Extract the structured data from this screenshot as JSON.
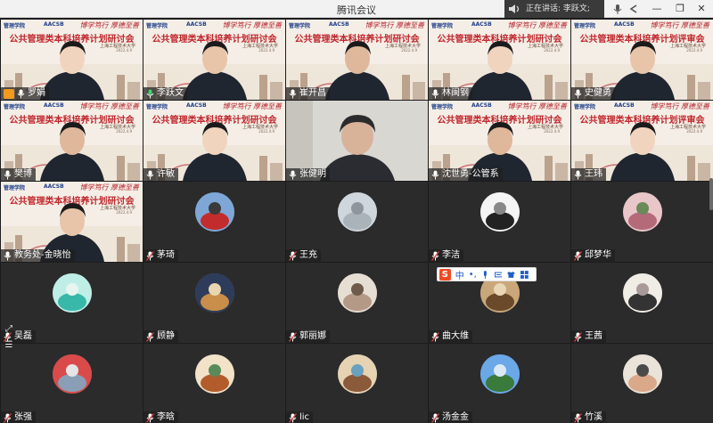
{
  "window": {
    "title": "腾讯会议",
    "speaking_label": "正在讲话: 李跃文;",
    "controls": [
      "—",
      "❐",
      "✕"
    ]
  },
  "slide": {
    "logo_left": "管理学院",
    "logo_right": "AACSB",
    "motto": "博学笃行 厚德至善",
    "title_seminar": "公共管理类本科培养计划研讨会",
    "title_review": "公共管理类本科培养计划评审会",
    "subtitle": "上海工程技术大学",
    "date": "2022.4.9"
  },
  "participants": [
    {
      "name": "罗娟",
      "type": "slide-person",
      "slide": "seminar",
      "host": true
    },
    {
      "name": "李跃文",
      "type": "slide-person",
      "slide": "seminar",
      "speaking": true
    },
    {
      "name": "崔开昌",
      "type": "slide-person",
      "slide": "seminar"
    },
    {
      "name": "林闽钢",
      "type": "slide-person",
      "slide": "seminar"
    },
    {
      "name": "史健勇",
      "type": "slide-person",
      "slide": "review"
    },
    {
      "name": "樊博",
      "type": "slide-person",
      "slide": "seminar"
    },
    {
      "name": "许敏",
      "type": "slide-person",
      "slide": "seminar"
    },
    {
      "name": "张健明",
      "type": "camera"
    },
    {
      "name": "沈世勇-公管系",
      "type": "slide-person",
      "slide": "seminar"
    },
    {
      "name": "王玮",
      "type": "slide-person",
      "slide": "review"
    },
    {
      "name": "教务处-金晓怡",
      "type": "slide-person",
      "slide": "seminar"
    },
    {
      "name": "茅琦",
      "type": "avatar",
      "avatar": "red-car"
    },
    {
      "name": "王充",
      "type": "avatar",
      "avatar": "foggy-landscape"
    },
    {
      "name": "李洁",
      "type": "avatar",
      "avatar": "sketch-character"
    },
    {
      "name": "邱梦华",
      "type": "avatar",
      "avatar": "pink-blossom"
    },
    {
      "name": "吴磊",
      "type": "avatar",
      "avatar": "teal-sea"
    },
    {
      "name": "顾静",
      "type": "avatar",
      "avatar": "cathedral"
    },
    {
      "name": "郭丽娜",
      "type": "avatar",
      "avatar": "cartoon-girl"
    },
    {
      "name": "曲大维",
      "type": "avatar",
      "avatar": "building-hall"
    },
    {
      "name": "王茜",
      "type": "avatar",
      "avatar": "line-drawing-girl"
    },
    {
      "name": "张强",
      "type": "avatar",
      "avatar": "red-roof"
    },
    {
      "name": "李晗",
      "type": "avatar",
      "avatar": "cartoon-boy"
    },
    {
      "name": "lic",
      "type": "avatar",
      "avatar": "cartoon-room"
    },
    {
      "name": "汤金金",
      "type": "avatar",
      "avatar": "blue-sky-tree"
    },
    {
      "name": "竹溪",
      "type": "avatar",
      "avatar": "baby"
    }
  ],
  "ime": {
    "logo": "S",
    "mode": "中",
    "punct": "•,"
  },
  "side_controls": {
    "expand": "⤢",
    "list": "☰"
  },
  "colors": {
    "slide_red": "#c0272d",
    "host_orange": "#f19a1e",
    "background": "#1c1c1e",
    "tile": "#2b2b2b"
  }
}
